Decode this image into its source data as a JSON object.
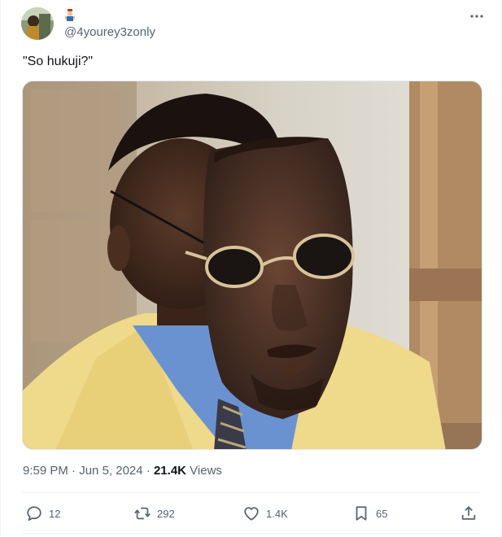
{
  "tweet": {
    "handle": "@4yourey3zonly",
    "text": "\"So hukuji?\"",
    "time": "9:59 PM",
    "sep1": " · ",
    "date": "Jun 5, 2024",
    "sep2": " · ",
    "views_count": "21.4K",
    "views_label": " Views"
  },
  "actions": {
    "replies": "12",
    "reposts": "292",
    "likes": "1.4K",
    "bookmarks": "65"
  },
  "colors": {
    "text_primary": "#0f1419",
    "text_secondary": "#536471",
    "divider": "#eff3f4"
  },
  "icons": [
    "avatar",
    "emoji-badge-icon",
    "more-icon",
    "reply-icon",
    "repost-icon",
    "like-icon",
    "bookmark-icon",
    "share-icon"
  ]
}
